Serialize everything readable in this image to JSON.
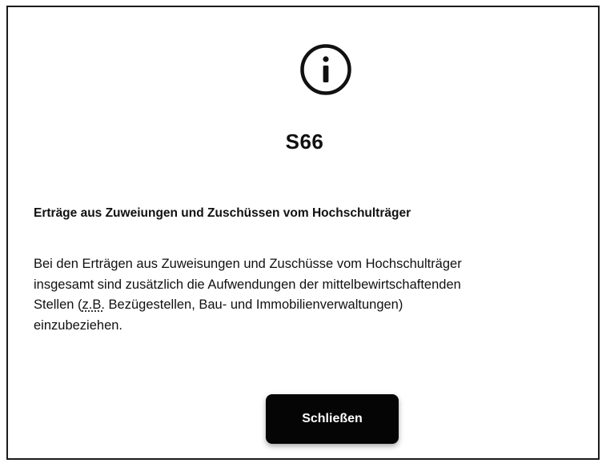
{
  "dialog": {
    "icon": "info-circle-icon",
    "code": "S66",
    "heading": "Erträge aus Zuweiungen und Zuschüssen vom Hochschulträger",
    "body": {
      "line1": "Bei den Erträgen aus Zuweisungen und Zuschüsse vom Hochschulträger",
      "line2": "insgesamt sind zusätzlich die Aufwendungen der mittelbewirtschaftenden",
      "line3_prefix": "Stellen (",
      "line3_abbr": "z.B.",
      "line3_suffix": " Bezügestellen, Bau- und Immobilienverwaltungen)",
      "line4": "einzubeziehen."
    },
    "close_label": "Schließen"
  },
  "colors": {
    "border": "#1a1a1a",
    "button_background": "#050505",
    "button_text": "#ffffff",
    "text": "#111111"
  }
}
